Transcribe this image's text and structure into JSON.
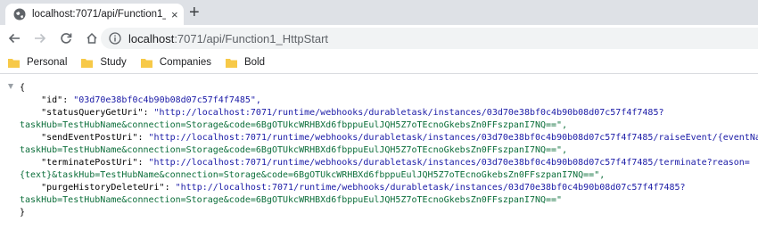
{
  "tab": {
    "title": "localhost:7071/api/Function1_HttpStart",
    "close": "×",
    "new_tab": "+"
  },
  "address": {
    "host": "localhost",
    "path": ":7071/api/Function1_HttpStart"
  },
  "bookmarks": [
    "Personal",
    "Study",
    "Companies",
    "Bold"
  ],
  "json": {
    "open_brace": "{",
    "close_brace": "}",
    "id_key": "\"id\"",
    "id_value": "\"03d70e38bf0c4b90b08d07c57f4f7485\",",
    "status_key": "\"statusQueryGetUri\"",
    "status_value": "\"http://localhost:7071/runtime/webhooks/durabletask/instances/03d70e38bf0c4b90b08d07c57f4f7485?",
    "status_cont": "taskHub=TestHubName&connection=Storage&code=6BgOTUkcWRHBXd6fbppuEulJQH5Z7oTEcnoGkebsZn0FFszpanI7NQ==\",",
    "send_key": "\"sendEventPostUri\"",
    "send_value": "\"http://localhost:7071/runtime/webhooks/durabletask/instances/03d70e38bf0c4b90b08d07c57f4f7485/raiseEvent/{eventName}?",
    "send_cont": "taskHub=TestHubName&connection=Storage&code=6BgOTUkcWRHBXd6fbppuEulJQH5Z7oTEcnoGkebsZn0FFszpanI7NQ==\",",
    "terminate_key": "\"terminatePostUri\"",
    "terminate_value": "\"http://localhost:7071/runtime/webhooks/durabletask/instances/03d70e38bf0c4b90b08d07c57f4f7485/terminate?reason=",
    "terminate_cont": "{text}&taskHub=TestHubName&connection=Storage&code=6BgOTUkcWRHBXd6fbppuEulJQH5Z7oTEcnoGkebsZn0FFszpanI7NQ==\",",
    "purge_key": "\"purgeHistoryDeleteUri\"",
    "purge_value": "\"http://localhost:7071/runtime/webhooks/durabletask/instances/03d70e38bf0c4b90b08d07c57f4f7485?",
    "purge_cont": "taskHub=TestHubName&connection=Storage&code=6BgOTUkcWRHBXd6fbppuEulJQH5Z7oTEcnoGkebsZn0FFszpanI7NQ==\""
  },
  "colors": {
    "string": "#1a1aa6",
    "folder": "#f7c948"
  }
}
